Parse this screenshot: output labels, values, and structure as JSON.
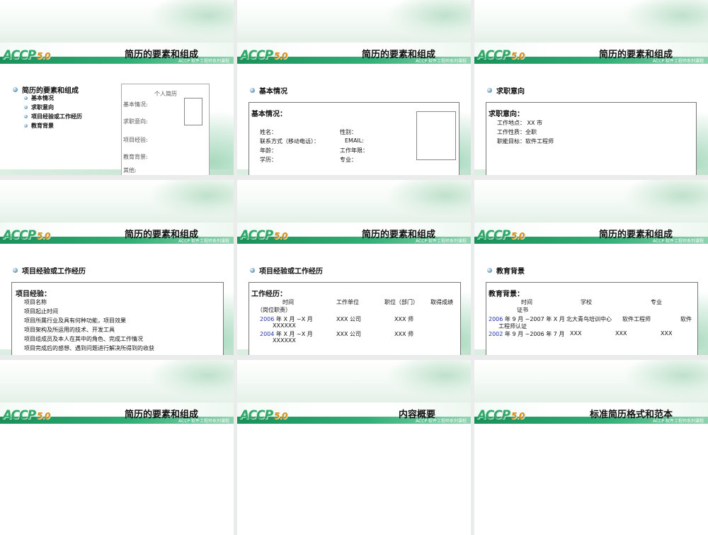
{
  "common": {
    "logo_text": "ACCP",
    "logo_version": "5.0",
    "subtitle": "ACCP 软件工程师系列课程"
  },
  "slides": [
    {
      "title": "简历的要素和组成",
      "main_bullet": "简历的要素和组成",
      "sub_bullets": [
        "基本情况",
        "求职意向",
        "项目经验或工作经历",
        "教育背景"
      ],
      "form_title": "个人简历",
      "form_fields": [
        "基本情况:",
        "求职意向:",
        "项目经验:",
        "教育背景:",
        "其他:"
      ]
    },
    {
      "title": "简历的要素和组成",
      "bullet": "基本情况",
      "box_heading": "基本情况：",
      "left_fields": [
        "姓名：",
        "联系方式（移动电话）：",
        "年龄：",
        "学历："
      ],
      "right_fields": [
        "性别：",
        "EMAIL:",
        "工作年限：",
        "专业："
      ]
    },
    {
      "title": "简历的要素和组成",
      "bullet": "求职意向",
      "box_heading": "求职意向：",
      "lines": [
        "工作地点： XX 市",
        "工作性质：全职",
        "职能目标：软件工程师"
      ]
    },
    {
      "title": "简历的要素和组成",
      "bullet": "项目经验或工作经历",
      "box_heading": "项目经验：",
      "lines": [
        "项目名称",
        "项目起止时间",
        "项目所属行业及具有何种功能，项目效果",
        "项目架构及所运用的技术、开发工具",
        "项目组成员及本人在其中的角色、完成工作情况",
        "项目完成后的感想、遇到问题进行解决所得到的收获"
      ]
    },
    {
      "title": "简历的要素和组成",
      "bullet": "项目经验或工作经历",
      "box_heading": "工作经历：",
      "headers": [
        "时间",
        "工作单位",
        "职位（部门）",
        "取得成绩"
      ],
      "header_wrap": "（岗位职责）",
      "rows": [
        {
          "year": "2006",
          "period": " 年 X 月 ~X 月",
          "period2": "XXXXXX",
          "company": "XXX 公司",
          "position": "XXX 师"
        },
        {
          "year": "2004",
          "period": " 年 X 月 ~X 月",
          "period2": "XXXXXX",
          "company": "XXX 公司",
          "position": "XXX 师"
        }
      ]
    },
    {
      "title": "简历的要素和组成",
      "bullet": "教育背景",
      "box_heading": "教育背景：",
      "headers": [
        "时间",
        "学校",
        "专业"
      ],
      "header_wrap": "证书",
      "rows": [
        {
          "year": "2006",
          "period": " 年 9 月 ~2007 年 X 月",
          "school": "北大青鸟培训中心",
          "major": "软件工程师",
          "cert": "软件",
          "cert2": "工程师认证"
        },
        {
          "year": "2002",
          "period": " 年 9 月 ~2006 年 7 月",
          "school": "XXX",
          "major": "XXX",
          "cert": "XXX",
          "cert2": ""
        }
      ]
    },
    {
      "title": "简历的要素和组成"
    },
    {
      "title": "内容概要"
    },
    {
      "title": "标准简历格式和范本"
    }
  ]
}
